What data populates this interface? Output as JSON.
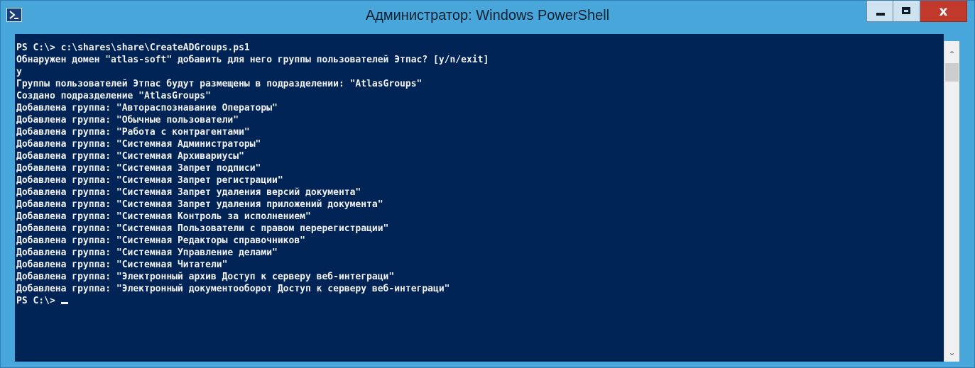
{
  "window": {
    "title": "Администратор: Windows PowerShell",
    "app_icon": "powershell-icon",
    "controls": {
      "minimize_icon": "minimize-icon",
      "maximize_icon": "maximize-icon",
      "close_icon": "close-icon",
      "close_label": "x"
    }
  },
  "console": {
    "background": "#012456",
    "foreground": "#f2f2f2",
    "lines": [
      "PS C:\\> c:\\shares\\share\\CreateADGroups.ps1",
      "Обнаружен домен \"atlas-soft\" добавить для него группы пользователей Этпас? [y/n/exit]",
      "y",
      "Группы пользователей Этпас будут размещены в подразделении: \"AtlasGroups\"",
      "Создано подразделение \"AtlasGroups\"",
      "Добавлена группа: \"Автораспознавание Операторы\"",
      "Добавлена группа: \"Обычные пользователи\"",
      "Добавлена группа: \"Работа с контрагентами\"",
      "Добавлена группа: \"Системная Администраторы\"",
      "Добавлена группа: \"Системная Архивариусы\"",
      "Добавлена группа: \"Системная Запрет подписи\"",
      "Добавлена группа: \"Системная Запрет регистрации\"",
      "Добавлена группа: \"Системная Запрет удаления версий документа\"",
      "Добавлена группа: \"Системная Запрет удаления приложений документа\"",
      "Добавлена группа: \"Системная Контроль за исполнением\"",
      "Добавлена группа: \"Системная Пользователи с правом перерегистрации\"",
      "Добавлена группа: \"Системная Редакторы справочников\"",
      "Добавлена группа: \"Системная Управление делами\"",
      "Добавлена группа: \"Системная Читатели\"",
      "Добавлена группа: \"Электронный архив Доступ к серверу веб-интеграци\"",
      "Добавлена группа: \"Электронный документооборот Доступ к серверу веб-интеграци\""
    ],
    "prompt": "PS C:\\> "
  },
  "scrollbar": {
    "up_icon": "scroll-up-icon",
    "down_icon": "scroll-down-icon"
  }
}
